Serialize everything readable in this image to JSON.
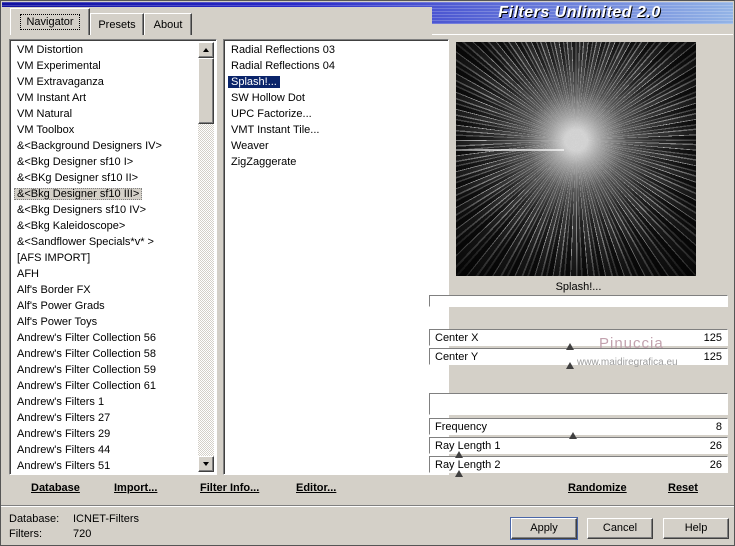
{
  "window": {
    "title": "Filters Unlimited 2.0"
  },
  "tabs": {
    "navigator": "Navigator",
    "presets": "Presets",
    "about": "About"
  },
  "navigator_list": {
    "selected_index": 9,
    "items": [
      "VM Distortion",
      "VM Experimental",
      "VM Extravaganza",
      "VM Instant Art",
      "VM Natural",
      "VM Toolbox",
      "&<Background Designers IV>",
      "&<Bkg Designer sf10 I>",
      "&<BKg Designer sf10 II>",
      "&<Bkg Designer sf10 III>",
      "&<Bkg Designers sf10 IV>",
      "&<Bkg Kaleidoscope>",
      "&<Sandflower Specials*v* >",
      "[AFS IMPORT]",
      "AFH",
      "Alf's Border FX",
      "Alf's Power Grads",
      "Alf's Power Toys",
      "Andrew's Filter Collection 56",
      "Andrew's Filter Collection 58",
      "Andrew's Filter Collection 59",
      "Andrew's Filter Collection 61",
      "Andrew's Filters 1",
      "Andrew's Filters 27",
      "Andrew's Filters 29",
      "Andrew's Filters 44",
      "Andrew's Filters 51"
    ]
  },
  "filter_list": {
    "selected_index": 2,
    "items": [
      "Radial Reflections 03",
      "Radial Reflections 04",
      "Splash!...",
      "SW Hollow Dot",
      "UPC Factorize...",
      "VMT Instant Tile...",
      "Weaver",
      "ZigZaggerate"
    ]
  },
  "preview": {
    "caption": "Splash!..."
  },
  "param_groups": {
    "top": [
      {
        "label": "Center X",
        "value": "125",
        "pct": 47
      },
      {
        "label": "Center Y",
        "value": "125",
        "pct": 47
      }
    ],
    "bottom": [
      {
        "label": "Frequency",
        "value": "8",
        "pct": 48
      },
      {
        "label": "Ray Length 1",
        "value": "26",
        "pct": 10
      },
      {
        "label": "Ray Length 2",
        "value": "26",
        "pct": 10
      }
    ]
  },
  "watermark": {
    "line1": "Pinuccia",
    "line2": "www.maidiregrafica.eu"
  },
  "toolbar": {
    "database": "Database",
    "import": "Import...",
    "filter_info": "Filter Info...",
    "editor": "Editor...",
    "randomize": "Randomize",
    "reset": "Reset"
  },
  "status": {
    "database_label": "Database:",
    "database_value": "ICNET-Filters",
    "filters_label": "Filters:",
    "filters_value": "720"
  },
  "buttons": {
    "apply": "Apply",
    "cancel": "Cancel",
    "help": "Help"
  }
}
